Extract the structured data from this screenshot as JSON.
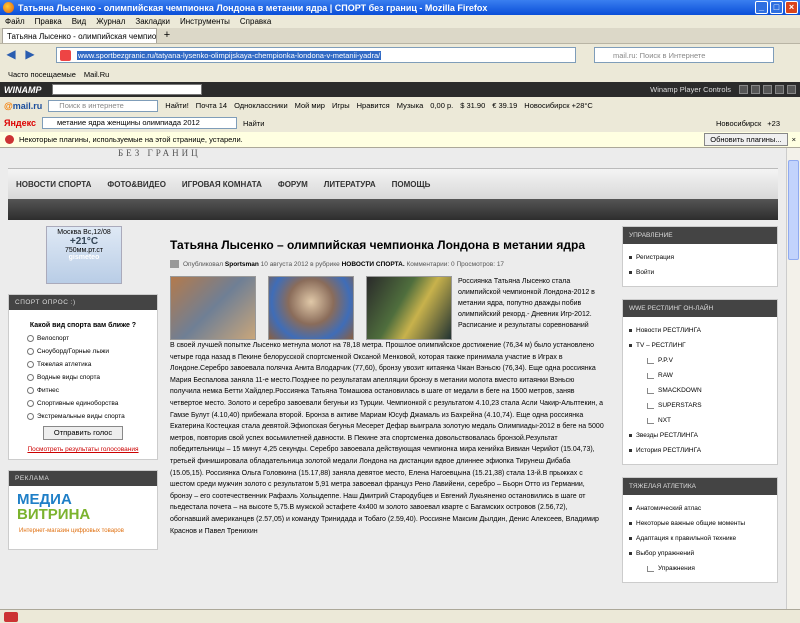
{
  "window": {
    "title": "Татьяна Лысенко - олимпийская чемпионка Лондона в метании ядра | СПОРТ без границ - Mozilla Firefox"
  },
  "menu": [
    "Файл",
    "Правка",
    "Вид",
    "Журнал",
    "Закладки",
    "Инструменты",
    "Справка"
  ],
  "tab": {
    "label": "Татьяна Лысенко - олимпийская чемпион..."
  },
  "address": {
    "url": "www.sportbezgranic.ru/tatyana-lysenko-olimpijskaya-chempionka-londona-v-metanii-yadra/",
    "search_placeholder": "mail.ru: Поиск в Интернете"
  },
  "bookmarks": [
    "Часто посещаемые",
    "Mail.Ru"
  ],
  "winamp": {
    "label": "WINAMP",
    "controls": "Winamp Player Controls"
  },
  "mailbar": {
    "logo_at": "@",
    "logo": "mail.ru",
    "search_placeholder": "Поиск в интернете",
    "items": [
      "Найти!",
      "Почта 14",
      "Одноклассники",
      "Мой мир",
      "Игры",
      "Нравится",
      "Музыка",
      "0,00 р.",
      "$ 31.90",
      "€ 39.19",
      "Новосибирск +28°C"
    ]
  },
  "yandex": {
    "logo": "Яндекс",
    "query": "метание ядра женщины олимпиада 2012",
    "find": "Найти",
    "city": "Новосибирск",
    "temp": "+23"
  },
  "notice": {
    "text": "Некоторые плагины, используемые на этой странице, устарели.",
    "button": "Обновить плагины..."
  },
  "site": {
    "slogan": "БЕЗ ГРАНИЦ",
    "nav": [
      "НОВОСТИ СПОРТА",
      "ФОТО&ВИДЕО",
      "ИГРОВАЯ КОМНАТА",
      "ФОРУМ",
      "ЛИТЕРАТУРА",
      "ПОМОЩЬ"
    ],
    "weather": {
      "date": "Москва Вс,12/08",
      "temp": "+21°C",
      "pressure": "750мм.рт.ст",
      "brand": "gismeteo"
    },
    "poll": {
      "header": "СПОРТ ОПРОС :)",
      "question": "Какой вид спорта вам ближе ?",
      "options": [
        "Велоспорт",
        "Сноуборд/Горные лыжи",
        "Тяжелая атлетика",
        "Водные виды спорта",
        "Фитнес",
        "Спортивные единоборства",
        "Экстремальные виды спорта"
      ],
      "vote": "Отправить голос",
      "results": "Посмотреть результаты голосования"
    },
    "ad": {
      "header": "РЕКЛАМА",
      "logo1": "МЕДИА",
      "logo2": "ВИТРИНА",
      "sub": "Интернет-магазин цифровых товаров"
    },
    "article": {
      "title": "Татьяна Лысенко – олимпийская чемпионка Лондона в метании ядра",
      "meta_pre": "Опубликовал",
      "author": "Sportsman",
      "meta_mid": "10 августа 2012 в рубрике",
      "category": "НОВОСТИ СПОРТА.",
      "comments": "Комментарии: 0",
      "views": "Просмотров: 17",
      "intro": "Россиянка Татьяна Лысенко стала олимпийской чемпионкой Лондона-2012 в метании ядра, попутно дважды побив олимпийский рекорд.- Дневник Игр-2012. Расписание и результаты соревнований",
      "body": "В своей лучшей попытке Лысенко метнула молот на 78,18 метра. Прошлое олимпийское достижение (76,34 м) было установлено четыре года назад в Пекине белорусской спортсменкой Оксаной Менковой, которая также принимала участие в Играх в Лондоне.Серебро завоевала полячка Анита Влодарчик (77,60), бронзу увозит китаянка Чжан Вэньсю (76,34). Еще одна россиянка Мария Беспалова заняла 11-е место.Позднее по результатам апелляции бронзу в метании молота вместо китаянки Вэньсю получила немка Бетти Хайдлер.Россиянка Татьяна Томашова остановилась в шаге от медали в беге на 1500 метров, заняв четвертое место. Золото и серебро завоевали бегуньи из Турции. Чемпионкой с результатом 4.10,23 стала Асли Чакир-Альптекин, а Гамзе Булут (4.10,40) прибежала второй. Бронза в активе Мариам Юсуф Джамаль из Бахрейна (4.10,74). Еще одна россиянка Екатерина Костецкая стала девятой.Эфиопская бегунья Месерет Дефар выиграла золотую медаль Олимпиады-2012 в беге на 5000 метров, повторив свой успех восьмилетней давности. В Пекине эта спортсменка довольствовалась бронзой.Результат победительницы – 15 минут 4,25 секунды. Серебро завоевала действующая чемпионка мира кенийка Вивиан Черийот (15.04,73), третьей финишировала обладательница золотой медали Лондона на дистанции вдвое длиннее эфиопка Тирунеш Дибаба (15.05,15). Россиянка Ольга Головкина (15.17,88) заняла девятое место, Елена Нагоевцына (15.21,38) стала 13-й.В прыжках с шестом среди мужчин золото с результатом 5,91 метра завоевал француз Рено Лавийени, серебро – Бьорн Отто из Германии, бронзу – его соотечественник Рафаэль Хольцдеппе. Наш Дмитрий Стародубцев и Евгений Лукьяненко остановились в шаге от пьедестала почета – на высоте 5,75.В мужской эстафете 4х400 м золото завоевал кварте с Багамских островов (2.56,72), обогнавший американцев (2.57,05) и команду Тринидада и Тобаго (2.59,40). Россияне Максим Дылдин, Денис Алексеев, Владимир Краснов и Павел Тренихин"
    },
    "right": [
      {
        "header": "УПРАВЛЕНИЕ",
        "items": [
          {
            "t": "Регистрация",
            "s": false
          },
          {
            "t": "Войти",
            "s": false
          }
        ]
      },
      {
        "header": "WWE РЕСТЛИНГ ОН-ЛАЙН",
        "items": [
          {
            "t": "Новости РЕСТЛИНГА",
            "s": false
          },
          {
            "t": "TV – РЕСТЛИНГ",
            "s": false
          },
          {
            "t": "P.P.V",
            "s": true
          },
          {
            "t": "RAW",
            "s": true
          },
          {
            "t": "SMACKDOWN",
            "s": true
          },
          {
            "t": "SUPERSTARS",
            "s": true
          },
          {
            "t": "NXT",
            "s": true
          },
          {
            "t": "Звезды РЕСТЛИНГА",
            "s": false
          },
          {
            "t": "История РЕСТЛИНГА",
            "s": false
          }
        ]
      },
      {
        "header": "ТЯЖЕЛАЯ АТЛЕТИКА",
        "items": [
          {
            "t": "Анатомический атлас",
            "s": false
          },
          {
            "t": "Некоторые важные общие моменты",
            "s": false
          },
          {
            "t": "Адаптация к правильной технике",
            "s": false
          },
          {
            "t": "Выбор упражнений",
            "s": false
          },
          {
            "t": "Упражнения",
            "s": true
          }
        ]
      }
    ]
  }
}
